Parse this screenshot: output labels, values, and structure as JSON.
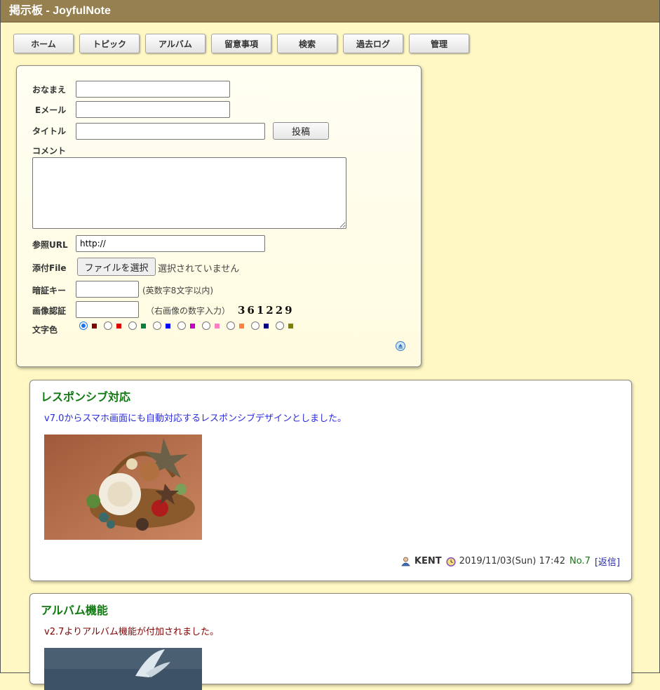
{
  "window": {
    "title": "掲示板 - JoyfulNote"
  },
  "menu": [
    "ホーム",
    "トピック",
    "アルバム",
    "留意事項",
    "検索",
    "過去ログ",
    "管理"
  ],
  "form": {
    "name_label": "おなまえ",
    "email_label": "Eメール",
    "title_label": "タイトル",
    "comment_label": "コメント",
    "url_label": "参照URL",
    "url_value": "http://",
    "file_label": "添付File",
    "file_button": "ファイルを選択",
    "file_status": "選択されていません",
    "password_label": "暗証キー",
    "password_note": "(英数字8文字以内)",
    "captcha_label": "画像認証",
    "captcha_note": "（右画像の数字入力）",
    "captcha_code": "361229",
    "color_label": "文字色",
    "colors": [
      "#800000",
      "#df0000",
      "#008040",
      "#0000ff",
      "#c100c1",
      "#ff80c0",
      "#ff8040",
      "#000080",
      "#808000"
    ],
    "selected_color_index": 0,
    "submit_label": "投稿"
  },
  "posts": [
    {
      "title": "レスポンシブ対応",
      "body": "v7.0からスマホ画面にも自動対応するレスポンシブデザインとしました。",
      "body_color": "#2a2adf",
      "author": "KENT",
      "datetime": "2019/11/03(Sun) 17:42",
      "number": "No.7",
      "reply": "[返信]"
    },
    {
      "title": "アルバム機能",
      "body": "v2.7よりアルバム機能が付加されました。",
      "body_color": "#800000"
    }
  ]
}
